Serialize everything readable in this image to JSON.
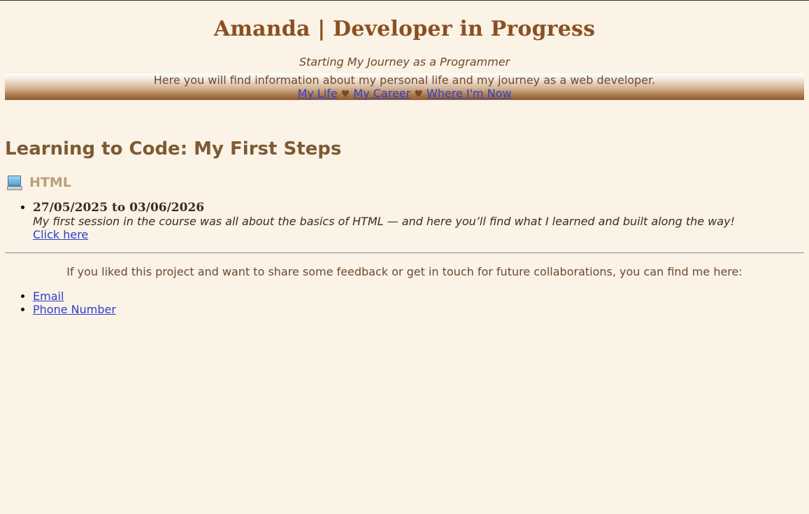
{
  "header": {
    "title": "Amanda | Developer in Progress",
    "tagline": "Starting My Journey as a Programmer"
  },
  "banner": {
    "intro": "Here you will find information about my personal life and my journey as a web developer.",
    "nav": [
      {
        "label": "My Life"
      },
      {
        "label": "My Career"
      },
      {
        "label": "Where I'm Now"
      }
    ],
    "separator": "♥"
  },
  "main": {
    "section_title": "Learning to Code: My First Steps",
    "subsection": {
      "icon": "computer-icon",
      "title": "HTML"
    },
    "entries": [
      {
        "date": "27/05/2025 to 03/06/2026",
        "description": "My first session in the course was all about the basics of HTML — and here you’ll find what I learned and built along the way!",
        "link_label": "Click here"
      }
    ]
  },
  "footer": {
    "contact_text": "If you liked this project and want to share some feedback or get in touch for future collaborations, you can find me here:",
    "links": [
      {
        "label": "Email"
      },
      {
        "label": "Phone Number"
      }
    ]
  },
  "colors": {
    "background": "#faf3e6",
    "title": "#8b4f22",
    "heading": "#7c5a34",
    "link": "#2b3fd1",
    "heart": "#7a4a22"
  }
}
